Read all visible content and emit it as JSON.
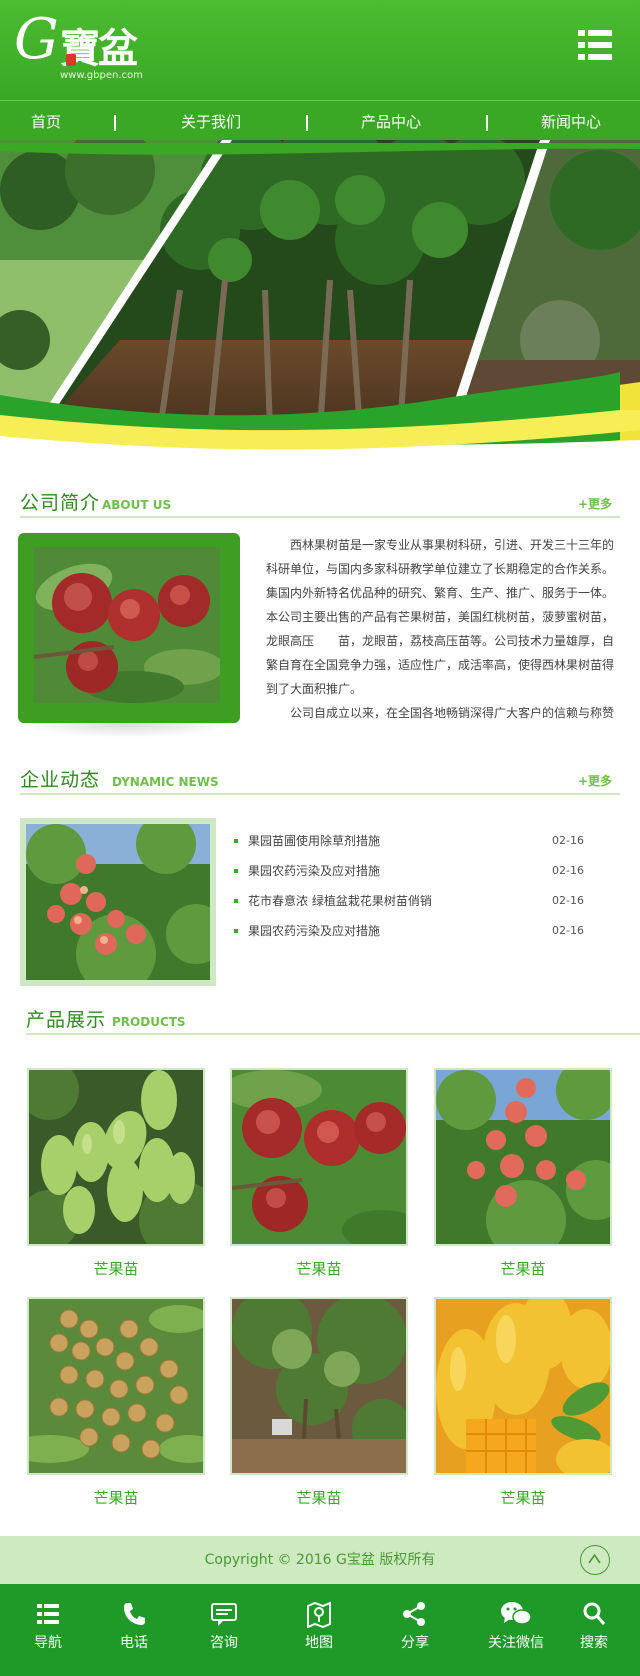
{
  "brand": {
    "logo_letter": "G",
    "logo_name": "寶盆",
    "logo_url": "www.gbpen.com"
  },
  "nav": [
    {
      "label": "首页"
    },
    {
      "label": "关于我们"
    },
    {
      "label": "产品中心"
    },
    {
      "label": "新闻中心"
    }
  ],
  "about": {
    "title_cn": "公司简介",
    "title_en": "ABOUT US",
    "more": "+更多",
    "paragraphs": [
      "西林果树苗是一家专业从事果树科研，引进、开发三十三年的科研单位，与国内多家科研教学单位建立了长期稳定的合作关系。集国内外新特名优品种的研究、繁育、生产、推广、服务于一体。本公司主要出售的产品有芒果树苗，美国红桃树苗，菠萝蜜树苗，龙眼高压　　苗，龙眼苗，荔枝高压苗等。公司技术力量雄厚，自繁自育在全国竞争力强，适应性广，成活率高，使得西林果树苗得到了大面积推广。",
      "公司自成立以来，在全国各地畅销深得广大客户的信赖与称赞"
    ]
  },
  "news": {
    "title_cn": "企业动态",
    "title_en": "DYNAMIC NEWS",
    "more": "+更多",
    "items": [
      {
        "title": "果园苗圃使用除草剂措施",
        "date": "02-16"
      },
      {
        "title": "果园农药污染及应对措施",
        "date": "02-16"
      },
      {
        "title": "花市春意浓 绿植盆栽花果树苗俏销",
        "date": "02-16"
      },
      {
        "title": "果园农药污染及应对措施",
        "date": "02-16"
      }
    ]
  },
  "products": {
    "title_cn": "产品展示",
    "title_en": "PRODUCTS",
    "items": [
      {
        "name": "芒果苗",
        "kind": "green-mango"
      },
      {
        "name": "芒果苗",
        "kind": "nectarine"
      },
      {
        "name": "芒果苗",
        "kind": "peach-tree"
      },
      {
        "name": "芒果苗",
        "kind": "longan"
      },
      {
        "name": "芒果苗",
        "kind": "seedling"
      },
      {
        "name": "芒果苗",
        "kind": "yellow-mango"
      }
    ]
  },
  "footer": {
    "copyright": "Copyright © 2016 G宝盆 版权所有"
  },
  "bottom_bar": [
    {
      "label": "导航",
      "icon": "list-icon"
    },
    {
      "label": "电话",
      "icon": "phone-icon"
    },
    {
      "label": "咨询",
      "icon": "chat-icon"
    },
    {
      "label": "地图",
      "icon": "map-icon"
    },
    {
      "label": "分享",
      "icon": "share-icon"
    },
    {
      "label": "关注微信",
      "icon": "wechat-icon"
    },
    {
      "label": "搜索",
      "icon": "search-icon"
    }
  ],
  "colors": {
    "brand": "#3aa825",
    "accent": "#f7a51e",
    "dark": "#1f9a28"
  }
}
